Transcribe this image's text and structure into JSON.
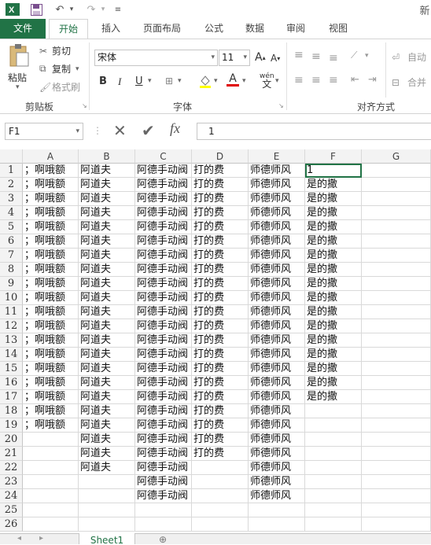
{
  "title_partial": "新",
  "tabs": [
    "文件",
    "开始",
    "插入",
    "页面布局",
    "公式",
    "数据",
    "审阅",
    "视图"
  ],
  "clipboard": {
    "paste": "粘贴",
    "cut": "剪切",
    "copy": "复制",
    "format_painter": "格式刷",
    "group": "剪贴板"
  },
  "font": {
    "name": "宋体",
    "size": "11",
    "bold": "B",
    "italic": "I",
    "underline": "U",
    "font_color": "A",
    "wen": "wén",
    "group": "字体"
  },
  "alignment": {
    "wrap": "自动",
    "merge": "合并",
    "group": "对齐方式"
  },
  "formula_bar": {
    "name_box": "F1",
    "value": "1",
    "fx": "fx"
  },
  "columns": [
    "A",
    "B",
    "C",
    "D",
    "E",
    "F",
    "G"
  ],
  "rows": [
    "1",
    "2",
    "3",
    "4",
    "5",
    "6",
    "7",
    "8",
    "9",
    "10",
    "11",
    "12",
    "13",
    "14",
    "15",
    "16",
    "17",
    "18",
    "19",
    "20",
    "21",
    "22",
    "23",
    "24",
    "25",
    "26"
  ],
  "col_a": [
    "；啊哦额",
    "；啊哦额",
    "；啊哦额",
    "；啊哦额",
    "；啊哦额",
    "；啊哦额",
    "；啊哦额",
    "；啊哦额",
    "；啊哦额",
    "；啊哦额",
    "；啊哦额",
    "；啊哦额",
    "；啊哦额",
    "；啊哦额",
    "；啊哦额",
    "；啊哦额",
    "；啊哦额",
    "；啊哦额",
    "；啊哦额"
  ],
  "col_b": [
    "阿道夫",
    "阿道夫",
    "阿道夫",
    "阿道夫",
    "阿道夫",
    "阿道夫",
    "阿道夫",
    "阿道夫",
    "阿道夫",
    "阿道夫",
    "阿道夫",
    "阿道夫",
    "阿道夫",
    "阿道夫",
    "阿道夫",
    "阿道夫",
    "阿道夫",
    "阿道夫",
    "阿道夫",
    "阿道夫",
    "阿道夫",
    "阿道夫"
  ],
  "col_c": [
    "阿德手动阀",
    "阿德手动阀",
    "阿德手动阀",
    "阿德手动阀",
    "阿德手动阀",
    "阿德手动阀",
    "阿德手动阀",
    "阿德手动阀",
    "阿德手动阀",
    "阿德手动阀",
    "阿德手动阀",
    "阿德手动阀",
    "阿德手动阀",
    "阿德手动阀",
    "阿德手动阀",
    "阿德手动阀",
    "阿德手动阀",
    "阿德手动阀",
    "阿德手动阀",
    "阿德手动阀",
    "阿德手动阀",
    "阿德手动阀",
    "阿德手动阀",
    "阿德手动阀"
  ],
  "col_d": [
    "打的费",
    "打的费",
    "打的费",
    "打的费",
    "打的费",
    "打的费",
    "打的费",
    "打的费",
    "打的费",
    "打的费",
    "打的费",
    "打的费",
    "打的费",
    "打的费",
    "打的费",
    "打的费",
    "打的费",
    "打的费",
    "打的费",
    "打的费",
    "打的费"
  ],
  "col_e": [
    "师德师风",
    "师德师风",
    "师德师风",
    "师德师风",
    "师德师风",
    "师德师风",
    "师德师风",
    "师德师风",
    "师德师风",
    "师德师风",
    "师德师风",
    "师德师风",
    "师德师风",
    "师德师风",
    "师德师风",
    "师德师风",
    "师德师风",
    "师德师风",
    "师德师风",
    "师德师风",
    "师德师风",
    "师德师风",
    "师德师风",
    "师德师风"
  ],
  "col_f": [
    "1",
    "是的撒",
    "是的撒",
    "是的撒",
    "是的撒",
    "是的撒",
    "是的撒",
    "是的撒",
    "是的撒",
    "是的撒",
    "是的撒",
    "是的撒",
    "是的撒",
    "是的撒",
    "是的撒",
    "是的撒",
    "是的撒"
  ],
  "sheet_tab": "Sheet1",
  "accent": "#217346"
}
